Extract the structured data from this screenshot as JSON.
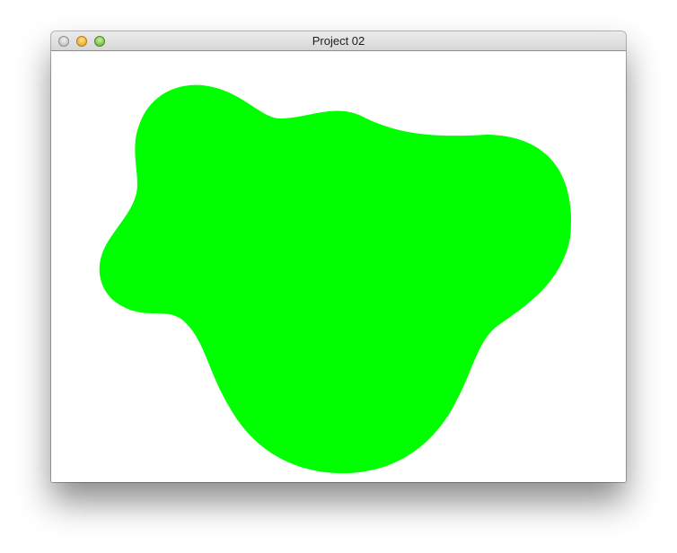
{
  "window": {
    "title": "Project 02"
  },
  "canvas": {
    "background_color": "#ffffff",
    "blob_color": "#00ff00"
  },
  "icons": {
    "close": "close-icon",
    "minimize": "minimize-icon",
    "zoom": "zoom-icon"
  }
}
